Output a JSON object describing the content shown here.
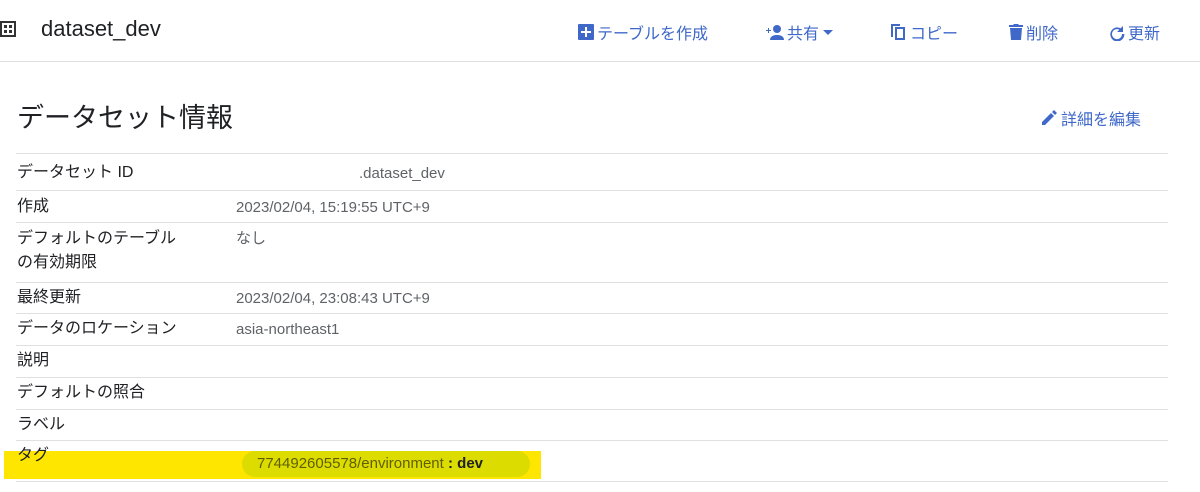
{
  "header": {
    "title": "dataset_dev",
    "actions": [
      {
        "label": "テーブルを作成",
        "icon": "add-box-icon"
      },
      {
        "label": "共有",
        "icon": "person-add-icon"
      },
      {
        "label": "コピー",
        "icon": "copy-icon"
      },
      {
        "label": "削除",
        "icon": "trash-icon"
      },
      {
        "label": "更新",
        "icon": "refresh-icon"
      }
    ]
  },
  "section": {
    "title": "データセット情報",
    "edit_label": "詳細を編集"
  },
  "rows": [
    {
      "key": "データセット ID",
      "value": ".dataset_dev"
    },
    {
      "key": "作成",
      "value": "2023/02/04, 15:19:55 UTC+9"
    },
    {
      "key": "デフォルトのテーブル\nの有効期限",
      "value": "なし"
    },
    {
      "key": "最終更新",
      "value": "2023/02/04, 23:08:43 UTC+9"
    },
    {
      "key": "データのロケーション",
      "value": "asia-northeast1"
    },
    {
      "key": "説明",
      "value": ""
    },
    {
      "key": "デフォルトの照合",
      "value": ""
    },
    {
      "key": "ラベル",
      "value": ""
    },
    {
      "key": "タグ",
      "value": ""
    }
  ],
  "tag": {
    "key": "774492605578/environment",
    "separator": " : ",
    "value": "dev"
  },
  "colors": {
    "accent": "#3f68c9",
    "highlight": "#ffe600"
  }
}
